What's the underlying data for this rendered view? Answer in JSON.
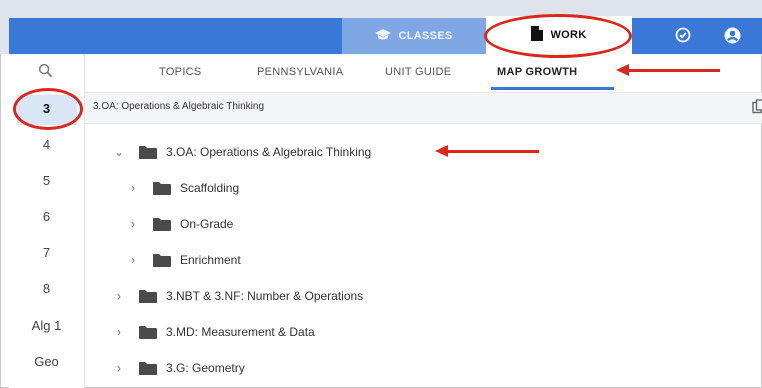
{
  "header": {
    "classes_label": "CLASSES",
    "work_label": "WORK"
  },
  "sidebar": {
    "items": [
      "3",
      "4",
      "5",
      "6",
      "7",
      "8",
      "Alg 1",
      "Geo"
    ]
  },
  "tabs": [
    "TOPICS",
    "PENNSYLVANIA",
    "UNIT GUIDE",
    "MAP GROWTH"
  ],
  "breadcrumb": "3.OA: Operations & Algebraic Thinking",
  "tree": [
    {
      "label": "3.OA: Operations & Algebraic Thinking",
      "expanded": true
    },
    {
      "label": "Scaffolding"
    },
    {
      "label": "On-Grade"
    },
    {
      "label": "Enrichment"
    },
    {
      "label": "3.NBT & 3.NF: Number & Operations"
    },
    {
      "label": "3.MD: Measurement & Data"
    },
    {
      "label": "3.G: Geometry"
    }
  ],
  "colors": {
    "accent": "#3a78d8",
    "annotation": "#d9281e"
  }
}
